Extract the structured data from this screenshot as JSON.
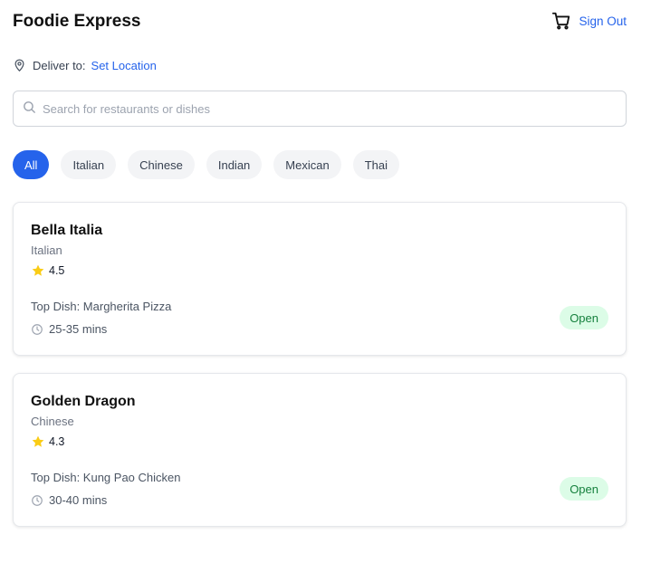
{
  "header": {
    "title": "Foodie Express",
    "cart_icon": "shopping-cart-icon",
    "sign_out_label": "Sign Out"
  },
  "location": {
    "icon": "map-pin-icon",
    "label": "Deliver to:",
    "link": "Set Location"
  },
  "search": {
    "icon": "search-icon",
    "placeholder": "Search for restaurants or dishes",
    "value": ""
  },
  "categories": {
    "selected": "All",
    "items": [
      {
        "label": "All"
      },
      {
        "label": "Italian"
      },
      {
        "label": "Chinese"
      },
      {
        "label": "Indian"
      },
      {
        "label": "Mexican"
      },
      {
        "label": "Thai"
      }
    ]
  },
  "restaurants": [
    {
      "name": "Bella Italia",
      "cuisine": "Italian",
      "rating": "4.5",
      "top_dish": "Top Dish: Margherita Pizza",
      "delivery_time": "25-35 mins",
      "status": "Open"
    },
    {
      "name": "Golden Dragon",
      "cuisine": "Chinese",
      "rating": "4.3",
      "top_dish": "Top Dish: Kung Pao Chicken",
      "delivery_time": "30-40 mins",
      "status": "Open"
    }
  ],
  "colors": {
    "accent": "#2563eb",
    "star": "#facc15",
    "status_bg": "#dcfce7",
    "status_text": "#15803d"
  }
}
